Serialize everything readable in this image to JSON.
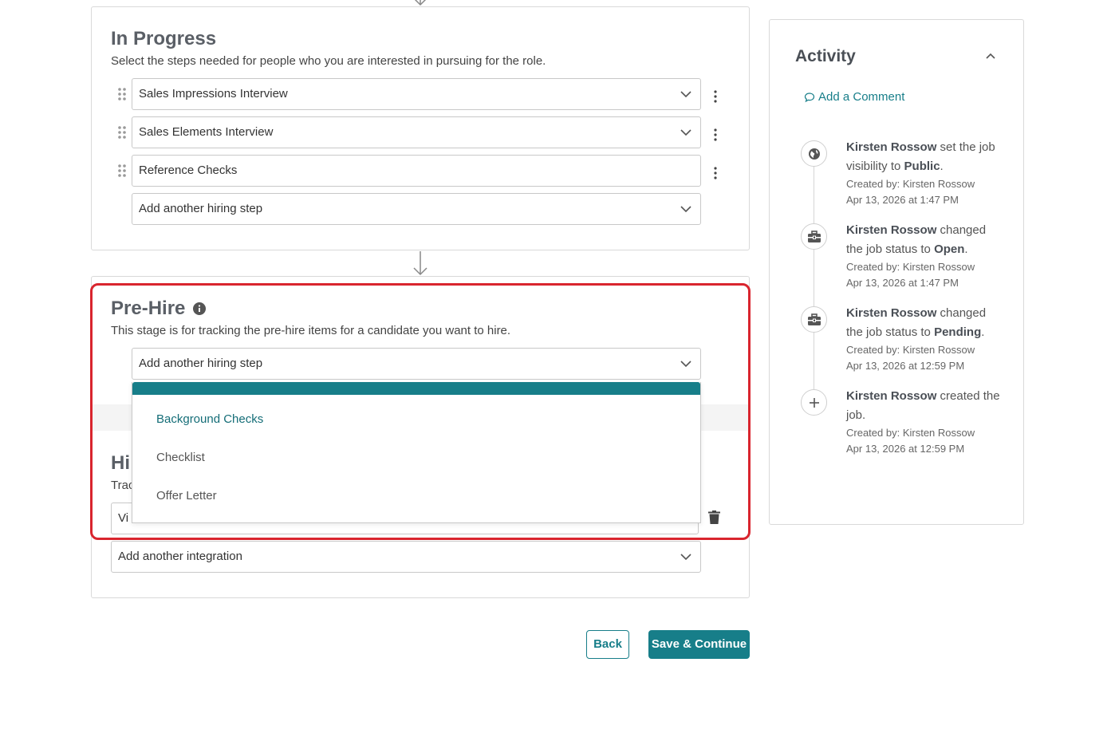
{
  "in_progress": {
    "title": "In Progress",
    "description": "Select the steps needed for people who you are interested in pursuing for the role.",
    "steps": [
      {
        "value": "Sales Impressions Interview"
      },
      {
        "value": "Sales Elements Interview"
      },
      {
        "value": "Reference Checks"
      }
    ],
    "add_placeholder": "Add another hiring step"
  },
  "pre_hire": {
    "title": "Pre-Hire",
    "description": "This stage is for tracking the pre-hire items for a candidate you want to hire.",
    "select_value": "Add another hiring step",
    "options": [
      "Background Checks",
      "Checklist",
      "Offer Letter"
    ]
  },
  "hired": {
    "title_partial": "Hi",
    "desc_partial": "Trac",
    "field_partial": "Vi",
    "add_integration": "Add another integration"
  },
  "buttons": {
    "back": "Back",
    "save": "Save & Continue"
  },
  "activity": {
    "title": "Activity",
    "add_comment": "Add a Comment",
    "entries": [
      {
        "icon": "globe-icon",
        "actor": "Kirsten Rossow",
        "text": "set the job visibility to",
        "value": "Public",
        "end": ".",
        "created_by": "Created by: Kirsten Rossow",
        "timestamp": "Apr 13, 2026 at 1:47 PM"
      },
      {
        "icon": "briefcase-icon",
        "actor": "Kirsten Rossow",
        "text": "changed the job status to",
        "value": "Open",
        "end": ".",
        "created_by": "Created by: Kirsten Rossow",
        "timestamp": "Apr 13, 2026 at 1:47 PM"
      },
      {
        "icon": "briefcase-icon",
        "actor": "Kirsten Rossow",
        "text": "changed the job status to",
        "value": "Pending",
        "end": ".",
        "created_by": "Created by: Kirsten Rossow",
        "timestamp": "Apr 13, 2026 at 12:59 PM"
      },
      {
        "icon": "plus-icon",
        "actor": "Kirsten Rossow",
        "text": "created the job.",
        "value": "",
        "end": "",
        "created_by": "Created by: Kirsten Rossow",
        "timestamp": "Apr 13, 2026 at 12:59 PM"
      }
    ]
  },
  "colors": {
    "accent": "#177e89",
    "highlight": "#d9252e",
    "heading": "#5a5f66"
  }
}
